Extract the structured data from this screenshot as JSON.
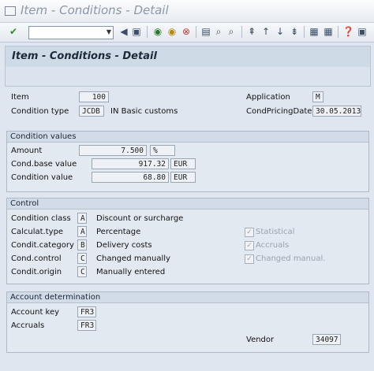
{
  "window": {
    "title": "Item - Conditions - Detail"
  },
  "page_title": "Item - Conditions - Detail",
  "item_section": {
    "item_label": "Item",
    "item_value": "100",
    "condition_type_label": "Condition type",
    "condition_type_value": "JCDB",
    "condition_type_desc": "IN Basic customs",
    "application_label": "Application",
    "application_value": "M",
    "cond_pricing_date_label": "CondPricingDate",
    "cond_pricing_date_value": "30.05.2013"
  },
  "condition_values": {
    "title": "Condition values",
    "amount_label": "Amount",
    "amount_value": "7.500",
    "amount_unit": "%",
    "base_label": "Cond.base value",
    "base_value": "917.32",
    "base_currency": "EUR",
    "cvalue_label": "Condition value",
    "cvalue_value": "68.80",
    "cvalue_currency": "EUR"
  },
  "control": {
    "title": "Control",
    "rows": [
      {
        "label": "Condition class",
        "code": "A",
        "desc": "Discount or surcharge"
      },
      {
        "label": "Calculat.type",
        "code": "A",
        "desc": "Percentage"
      },
      {
        "label": "Condit.category",
        "code": "B",
        "desc": "Delivery costs"
      },
      {
        "label": "Cond.control",
        "code": "C",
        "desc": "Changed manually"
      },
      {
        "label": "Condit.origin",
        "code": "C",
        "desc": "Manually entered"
      }
    ],
    "checkboxes": [
      {
        "label": "Statistical",
        "checked": true
      },
      {
        "label": "Accruals",
        "checked": true
      },
      {
        "label": "Changed manual.",
        "checked": true
      }
    ]
  },
  "account_determination": {
    "title": "Account determination",
    "account_key_label": "Account key",
    "account_key_value": "FR3",
    "accruals_label": "Accruals",
    "accruals_value": "FR3",
    "vendor_label": "Vendor",
    "vendor_value": "34097"
  },
  "colors": {
    "header_bg": "#cfdae7",
    "group_bg": "#e3e9f1",
    "title_color": "#8c98a8"
  }
}
